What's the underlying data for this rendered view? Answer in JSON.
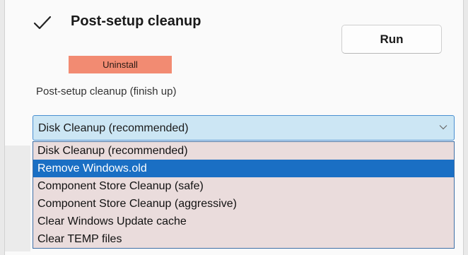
{
  "section": {
    "title": "Post-setup cleanup",
    "check_icon": "checkmark-icon"
  },
  "buttons": {
    "run_label": "Run",
    "uninstall_label": "Uninstall",
    "uninstall_color": "#f28b72"
  },
  "cleanup": {
    "field_label": "Post-setup cleanup (finish up)",
    "selected_value": "Disk Cleanup (recommended)",
    "chevron_icon": "chevron-down-icon",
    "highlight_color": "#1a6fc4",
    "options": [
      "Disk Cleanup (recommended)",
      "Remove Windows.old",
      "Component Store Cleanup (safe)",
      "Component Store Cleanup (aggressive)",
      "Clear Windows Update cache",
      "Clear TEMP files"
    ],
    "highlighted_option": "Remove Windows.old"
  }
}
